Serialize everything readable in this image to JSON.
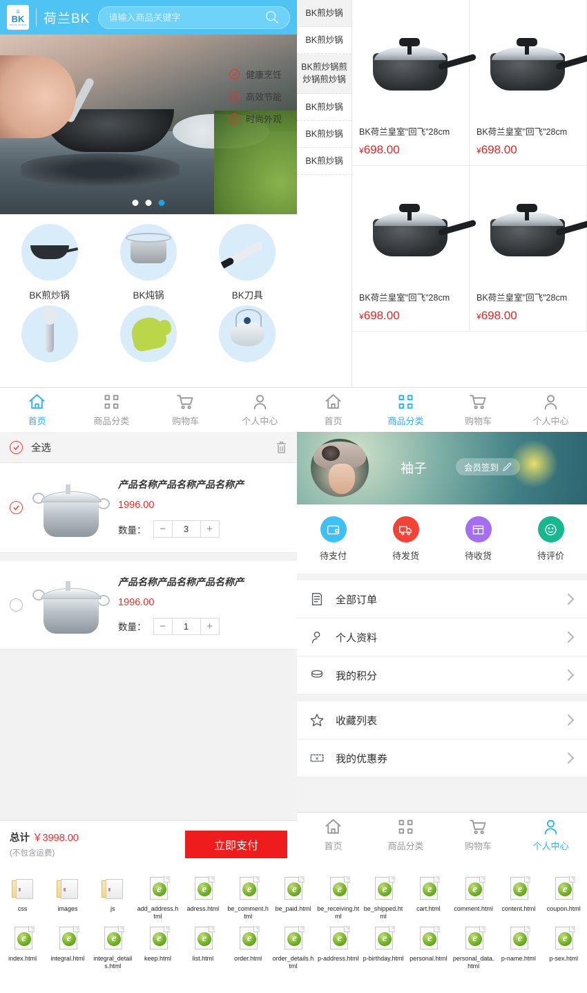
{
  "colors": {
    "brand_blue": "#4fc3f3",
    "accent_blue": "#2cb3f0",
    "price_red": "#ee2020",
    "pay_red": "#ee1c1c"
  },
  "home": {
    "brand": "荷兰BK",
    "logo_text": "BK",
    "search": {
      "placeholder": "请输入商品关键字",
      "value": "",
      "icon": "search-icon"
    },
    "hero": {
      "features": [
        "健康烹饪",
        "高效节能",
        "时尚外观"
      ],
      "dots": 3,
      "active_dot": 3
    },
    "categories": [
      {
        "label": "BK煎炒锅",
        "icon": "frying-pan-icon"
      },
      {
        "label": "BK炖锅",
        "icon": "stock-pot-icon"
      },
      {
        "label": "BK刀具",
        "icon": "knife-icon"
      },
      {
        "label": "",
        "icon": "spoon-icon"
      },
      {
        "label": "",
        "icon": "oven-glove-icon"
      },
      {
        "label": "",
        "icon": "teapot-icon"
      }
    ]
  },
  "category_page": {
    "sidebar": [
      {
        "label": "BK煎炒锅",
        "active": true
      },
      {
        "label": "BK煎炒锅",
        "active": false
      },
      {
        "label": "BK煎炒锅煎炒锅煎炒锅",
        "active": true
      },
      {
        "label": "BK煎炒锅",
        "active": false
      },
      {
        "label": "BK煎炒锅",
        "active": false
      },
      {
        "label": "BK煎炒锅",
        "active": false
      }
    ],
    "products": [
      {
        "name": "BK荷兰皇室\"回飞\"28cm",
        "price": "698.00",
        "currency": "¥"
      },
      {
        "name": "BK荷兰皇室\"回飞\"28cm",
        "price": "698.00",
        "currency": "¥"
      },
      {
        "name": "BK荷兰皇室\"回飞\"28cm",
        "price": "698.00",
        "currency": "¥"
      },
      {
        "name": "BK荷兰皇室\"回飞\"28cm",
        "price": "698.00",
        "currency": "¥"
      }
    ]
  },
  "tabbar": {
    "items": [
      {
        "label": "首页",
        "icon": "home-icon"
      },
      {
        "label": "商品分类",
        "icon": "grid-icon"
      },
      {
        "label": "购物车",
        "icon": "cart-icon"
      },
      {
        "label": "个人中心",
        "icon": "person-icon"
      }
    ],
    "active_home": 0,
    "active_category": 1,
    "active_profile": 3
  },
  "cart": {
    "select_all_label": "全选",
    "select_all_checked": true,
    "delete_icon": "trash-icon",
    "qty_label": "数量：",
    "minus": "−",
    "plus": "+",
    "items": [
      {
        "name": "产品名称产品名称产品名称产",
        "price": "1996.00",
        "qty": "3",
        "checked": true
      },
      {
        "name": "产品名称产品名称产品名称产",
        "price": "1996.00",
        "qty": "1",
        "checked": false
      }
    ],
    "total_label": "总计",
    "total_amount": "￥3998.00",
    "shipping_note": "(不包含运费)",
    "pay_button": "立即支付"
  },
  "profile": {
    "username": "袖子",
    "signin_label": "会员签到",
    "signin_icon": "pen-icon",
    "avatar_icon": "avatar",
    "orders": [
      {
        "label": "待支付",
        "color": "#3ec0f5",
        "icon": "wallet-icon"
      },
      {
        "label": "待发货",
        "color": "#f44336",
        "icon": "truck-icon"
      },
      {
        "label": "待收货",
        "color": "#a56ef0",
        "icon": "box-icon"
      },
      {
        "label": "待评价",
        "color": "#17b890",
        "icon": "smile-icon"
      }
    ],
    "menu": [
      {
        "label": "全部订单",
        "icon": "order-list-icon"
      },
      {
        "label": "个人资料",
        "icon": "person-icon"
      },
      {
        "label": "我的积分",
        "icon": "coins-icon"
      },
      {
        "label": "收藏列表",
        "icon": "star-icon"
      },
      {
        "label": "我的优惠券",
        "icon": "coupon-icon"
      }
    ]
  },
  "files": {
    "row1": [
      {
        "name": "css",
        "type": "folder"
      },
      {
        "name": "images",
        "type": "folder"
      },
      {
        "name": "js",
        "type": "folder"
      },
      {
        "name": "add_address.html",
        "type": "html"
      },
      {
        "name": "adress.html",
        "type": "html"
      },
      {
        "name": "be_comment.html",
        "type": "html"
      },
      {
        "name": "be_paid.html",
        "type": "html"
      },
      {
        "name": "be_receiving.html",
        "type": "html"
      },
      {
        "name": "be_shipped.html",
        "type": "html"
      },
      {
        "name": "cart.html",
        "type": "html"
      },
      {
        "name": "comment.html",
        "type": "html"
      },
      {
        "name": "content.html",
        "type": "html"
      },
      {
        "name": "coupon.html",
        "type": "html"
      }
    ],
    "row2": [
      {
        "name": "index.html",
        "type": "html"
      },
      {
        "name": "integral.html",
        "type": "html"
      },
      {
        "name": "integral_details.html",
        "type": "html"
      },
      {
        "name": "keep.html",
        "type": "html"
      },
      {
        "name": "list.html",
        "type": "html"
      },
      {
        "name": "order.html",
        "type": "html"
      },
      {
        "name": "order_details.html",
        "type": "html"
      },
      {
        "name": "p-address.html",
        "type": "html"
      },
      {
        "name": "p-birthday.html",
        "type": "html"
      },
      {
        "name": "personal.html",
        "type": "html"
      },
      {
        "name": "personal_data.html",
        "type": "html"
      },
      {
        "name": "p-name.html",
        "type": "html"
      },
      {
        "name": "p-sex.html",
        "type": "html"
      }
    ]
  }
}
